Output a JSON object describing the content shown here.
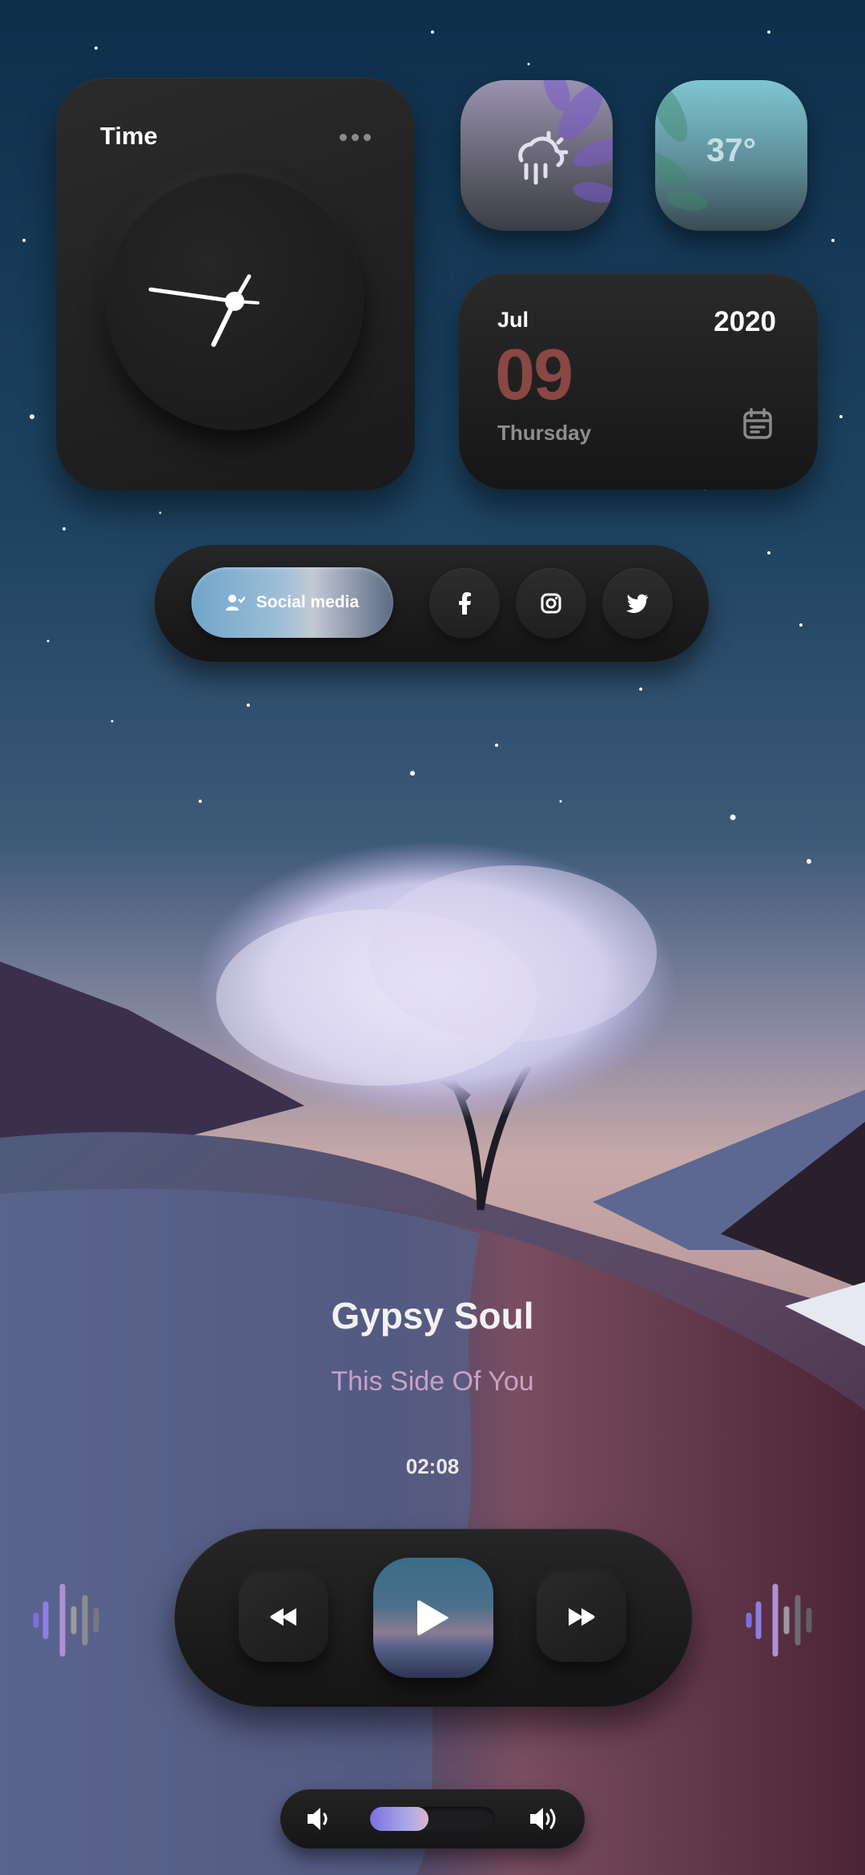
{
  "time_widget": {
    "title": "Time",
    "hour_hand_deg": 206,
    "minute_hand_deg": 278,
    "second_hand_deg": 30
  },
  "weather": {
    "temperature": "37°",
    "condition_icon": "cloud-sun-rain-icon"
  },
  "date_widget": {
    "month": "Jul",
    "year": "2020",
    "day": "09",
    "weekday": "Thursday"
  },
  "social": {
    "button_label": "Social media",
    "icons": [
      "facebook-icon",
      "instagram-icon",
      "twitter-icon"
    ]
  },
  "song": {
    "title": "Gypsy Soul",
    "artist": "This Side Of You",
    "elapsed": "02:08"
  },
  "volume": {
    "level": 0.47
  },
  "colors": {
    "date_accent": "#8a4744",
    "artist": "#c9a0c6",
    "eq_purple": "#8b7fe6"
  }
}
